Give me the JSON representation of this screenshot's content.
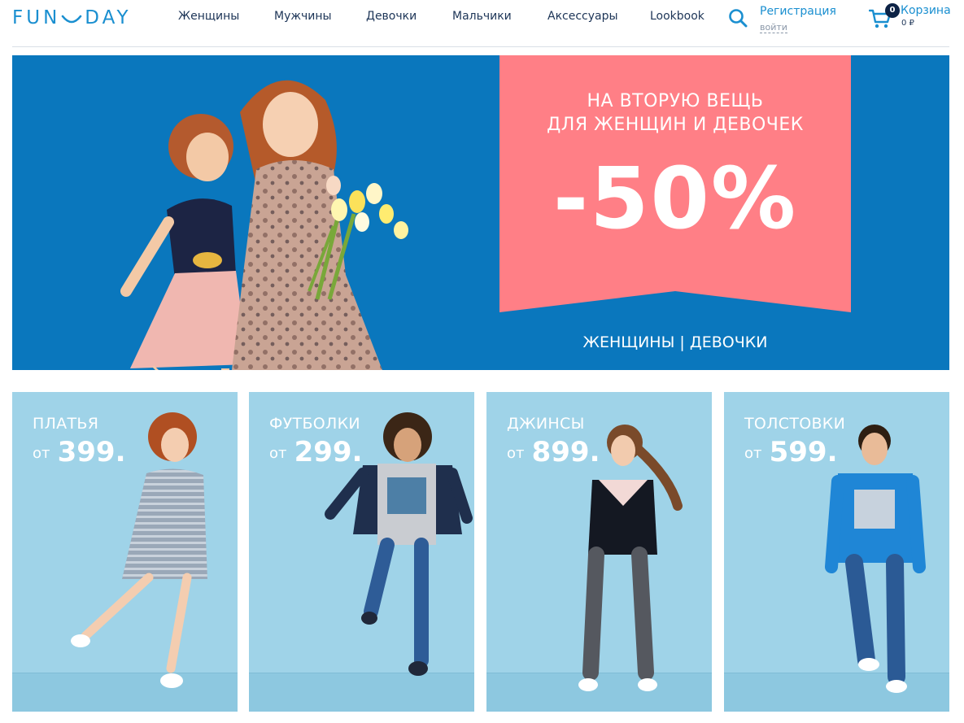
{
  "header": {
    "logo_left": "FUN",
    "logo_right": "DAY",
    "nav": [
      {
        "label": "Женщины"
      },
      {
        "label": "Мужчины"
      },
      {
        "label": "Девочки"
      },
      {
        "label": "Мальчики"
      },
      {
        "label": "Аксессуары"
      },
      {
        "label": "Lookbook"
      }
    ],
    "search_icon": "search-icon",
    "register_label": "Регистрация",
    "login_label": "войти",
    "cart": {
      "count": "0",
      "label": "Корзина",
      "total": "0 ₽",
      "icon": "cart-icon"
    }
  },
  "hero": {
    "line1": "НА ВТОРУЮ ВЕЩЬ",
    "line2": "ДЛЯ ЖЕНЩИН И ДЕВОЧЕК",
    "discount": "-50%",
    "link_women": "ЖЕНЩИНЫ",
    "separator": "|",
    "link_girls": "ДЕВОЧКИ"
  },
  "tiles": [
    {
      "title": "ПЛАТЬЯ",
      "from": "от",
      "price": "399."
    },
    {
      "title": "ФУТБОЛКИ",
      "from": "от",
      "price": "299."
    },
    {
      "title": "ДЖИНСЫ",
      "from": "от",
      "price": "899."
    },
    {
      "title": "ТОЛСТОВКИ",
      "from": "от",
      "price": "599."
    }
  ],
  "colors": {
    "brand": "#1a8fd0",
    "hero_bg": "#0a77bd",
    "promo_card": "#ff7f86",
    "tile_bg": "#9fd3e8",
    "nav_text": "#1d3557"
  }
}
